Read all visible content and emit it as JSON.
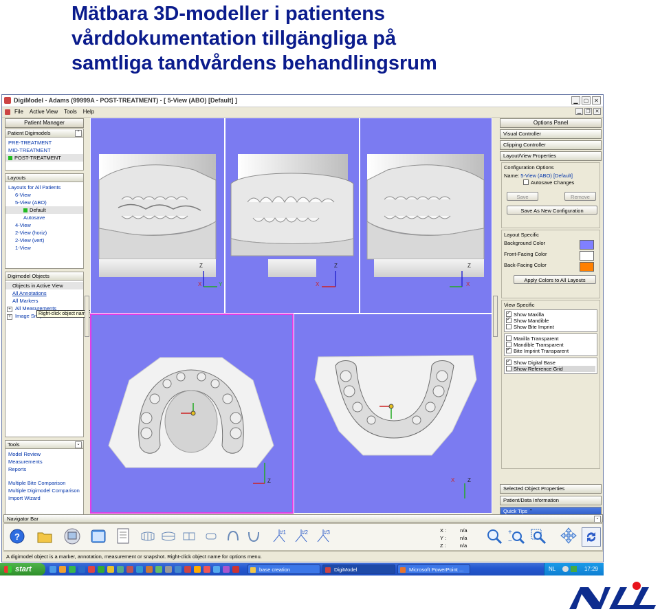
{
  "slide": {
    "title_lines": [
      "Mätbara 3D-modeller i patientens",
      "vårddokumentation tillgängliga på",
      "samtliga tandvårdens behandlingsrum"
    ]
  },
  "window": {
    "title": "DigiModel - Adams (99999A - POST-TREATMENT) - [ 5-View (ABO) [Default] ]",
    "menu": [
      "File",
      "Active View",
      "Tools",
      "Help"
    ]
  },
  "left": {
    "header": "Patient Manager",
    "patient_digimodels": {
      "title": "Patient Digimodels",
      "items": [
        "PRE-TREATMENT",
        "MID-TREATMENT",
        "POST-TREATMENT"
      ]
    },
    "layouts": {
      "title": "Layouts",
      "root": "Layouts for All Patients",
      "items": [
        "6-View",
        "5-View (ABO)",
        "Default",
        "Autosave",
        "4-View",
        "2-View (horiz)",
        "2-View (vert)",
        "1-View"
      ]
    },
    "digimodel_objects": {
      "title": "Digimodel Objects",
      "items": [
        "Objects in Active View",
        "All Annotations",
        "All Markers",
        "All Measurements",
        "Image Snapshots"
      ]
    },
    "tooltip": "Right-click object name for options menu",
    "tools": {
      "title": "Tools",
      "items": [
        "Model Review",
        "Measurements",
        "Reports",
        "Multiple Bite Comparison",
        "Multiple Digimodel Comparison",
        "Import Wizard"
      ]
    }
  },
  "viewports": {
    "z": "Z",
    "x": "X",
    "y": "Y"
  },
  "right": {
    "header": "Options Panel",
    "visual_controller": "Visual Controller",
    "clipping_controller": "Clipping Controller",
    "layout_view_properties": "Layout/View Properties",
    "config": {
      "title": "Configuration Options",
      "name_label": "Name:",
      "name_value": "5-View (ABO)",
      "name_default": "[Default]",
      "autosave": "Autosave Changes",
      "save": "Save",
      "remove": "Remove",
      "save_new": "Save As New Configuration"
    },
    "layout_specific": {
      "title": "Layout Specific",
      "background": "Background Color",
      "front": "Front-Facing Color",
      "back": "Back-Facing Color",
      "apply": "Apply Colors to All Layouts"
    },
    "view_specific": {
      "title": "View Specific",
      "group1": [
        {
          "label": "Show Maxilla",
          "on": true
        },
        {
          "label": "Show Mandible",
          "on": true
        },
        {
          "label": "Show Bite Imprint",
          "on": false
        }
      ],
      "group2": [
        {
          "label": "Maxilla Transparent",
          "on": false
        },
        {
          "label": "Mandible Transparent",
          "on": false
        },
        {
          "label": "Bite Imprint Transparent",
          "on": true
        }
      ],
      "group3": [
        {
          "label": "Show Digital Base",
          "on": true
        },
        {
          "label": "Show Reference Grid",
          "on": false
        }
      ]
    },
    "selected_object_properties": "Selected Object Properties",
    "patient_data_information": "Patient/Data Information",
    "quick_tips": "Quick Tips"
  },
  "navigator": {
    "title": "Navigator Bar",
    "bite1": "#1",
    "bite2": "#2",
    "bite3": "#3",
    "coords": {
      "x_label": "X :",
      "y_label": "Y :",
      "z_label": "Z :",
      "x": "n/a",
      "y": "n/a",
      "z": "n/a"
    }
  },
  "status": "A digimodel object is a marker, annotation, measurement or snapshot. Right-click object name for options menu.",
  "taskbar": {
    "start": "start",
    "tasks": [
      "base creation",
      "DigiModel",
      "Microsoft PowerPoint ..."
    ],
    "lang": "NL",
    "clock": "17:29"
  },
  "colors": {
    "title": "#0a1b8c",
    "viewport_bg": "#7b7bf1",
    "active_viewport_border": "#e33ce6",
    "background_swatch": "#8080ff",
    "front_swatch": "#ffffff",
    "back_swatch": "#ff8000",
    "logo_blue": "#0d2c8e",
    "logo_red": "#e8131b"
  }
}
